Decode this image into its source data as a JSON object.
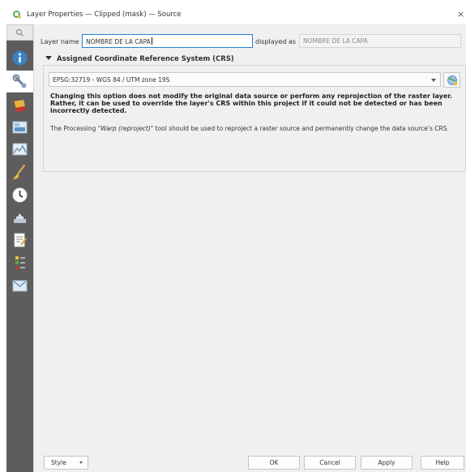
{
  "window": {
    "title": "Layer Properties — Clipped (mask) — Source",
    "close_glyph": "×"
  },
  "sidebar": {
    "items": [
      {
        "name": "information",
        "icon": "info-icon",
        "active": false
      },
      {
        "name": "source",
        "icon": "source-wrench-icon",
        "active": true
      },
      {
        "name": "symbology",
        "icon": "paint-icon",
        "active": false
      },
      {
        "name": "transparency",
        "icon": "transparency-icon",
        "active": false
      },
      {
        "name": "histogram",
        "icon": "histogram-icon",
        "active": false
      },
      {
        "name": "rendering",
        "icon": "brush-icon",
        "active": false
      },
      {
        "name": "temporal",
        "icon": "clock-icon",
        "active": false
      },
      {
        "name": "pyramids",
        "icon": "pyramids-icon",
        "active": false
      },
      {
        "name": "metadata",
        "icon": "metadata-icon",
        "active": false
      },
      {
        "name": "legend",
        "icon": "legend-icon",
        "active": false
      },
      {
        "name": "qgis-server",
        "icon": "server-icon",
        "active": false
      }
    ]
  },
  "form": {
    "layer_name_label": "Layer name",
    "layer_name_value": "NOMBRE DE LA CAPA",
    "displayed_as_label": "displayed as",
    "displayed_as_value": "NOMBRE DE LA CAPA"
  },
  "crs": {
    "group_title": "Assigned Coordinate Reference System (CRS)",
    "selected": "EPSG:32719 - WGS 84 / UTM zone 19S",
    "warning": "Changing this option does not modify the original data source or perform any reprojection of the raster layer. Rather, it can be used to override the layer's CRS within this project if it could not be detected or has been incorrectly detected.",
    "note_prefix": "The Processing \"",
    "note_tool": "Warp (reproject)",
    "note_suffix": "\" tool should be used to reproject a raster source and permanently change the data source's CRS."
  },
  "buttons": {
    "style": "Style",
    "ok": "OK",
    "cancel": "Cancel",
    "apply": "Apply",
    "help": "Help"
  },
  "colors": {
    "sidebar_bg": "#5d5d5d",
    "content_bg": "#f0f0f0",
    "focus_border": "#2a7fd4",
    "qgis_green": "#4caf50"
  }
}
